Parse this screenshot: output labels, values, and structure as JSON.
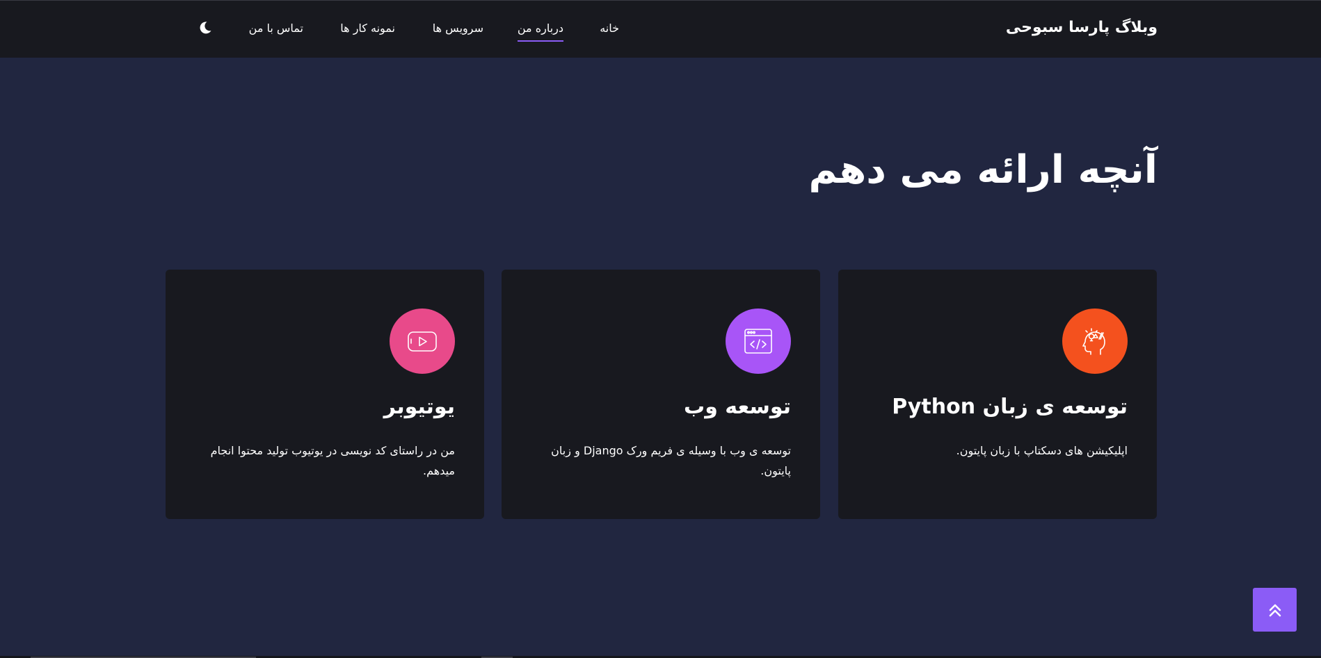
{
  "nav": {
    "brand": "وبلاگ پارسا سبوحی",
    "links": [
      {
        "label": "خانه"
      },
      {
        "label": "درباره من"
      },
      {
        "label": "سرویس ها"
      },
      {
        "label": "نمونه کار ها"
      },
      {
        "label": "تماس با من"
      }
    ],
    "theme_toggle_icon": "moon-icon"
  },
  "services": {
    "title": "آنچه ارائه می دهم",
    "cards": [
      {
        "title": "توسعه ی زبان Python",
        "description": "اپلیکیشن های دسکتاپ با زبان پایتون.",
        "icon": "head-ideas-icon",
        "color": "#f4511e"
      },
      {
        "title": "توسعه وب",
        "description": "توسعه ی وب با وسیله ی فریم ورک Django و زبان پایتون.",
        "icon": "browser-code-icon",
        "color": "#a855f7"
      },
      {
        "title": "یوتیوبر",
        "description": "من در راستای کد نویسی در یوتیوب تولید محتوا انجام میدهم.",
        "icon": "youtube-play-icon",
        "color": "#e84a8a"
      }
    ]
  },
  "back_to_top_icon": "double-chevron-up-icon",
  "colors": {
    "background": "#212640",
    "navbar": "#18191f",
    "card": "#18191f",
    "accent": "#8b5cf6"
  }
}
